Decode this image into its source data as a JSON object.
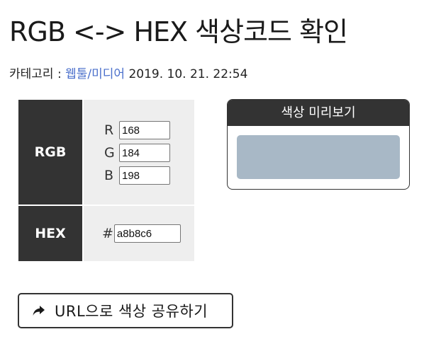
{
  "page": {
    "title": "RGB <-> HEX 색상코드 확인"
  },
  "meta": {
    "category_prefix": "카테고리 : ",
    "category_link": "웹툴/미디어",
    "datetime": "2019. 10. 21. 22:54"
  },
  "converter": {
    "rgb_header": "RGB",
    "hex_header": "HEX",
    "r_label": "R",
    "g_label": "G",
    "b_label": "B",
    "r_value": "168",
    "g_value": "184",
    "b_value": "198",
    "hash_symbol": "#",
    "hex_value": "a8b8c6"
  },
  "preview": {
    "title": "색상 미리보기",
    "color": "#a8b8c6"
  },
  "share": {
    "label": "URL으로  색상  공유하기",
    "icon": "share-arrow-icon"
  },
  "colors": {
    "header_bg": "#333333",
    "cell_bg": "#eeeeee",
    "link": "#4a6fcb"
  }
}
